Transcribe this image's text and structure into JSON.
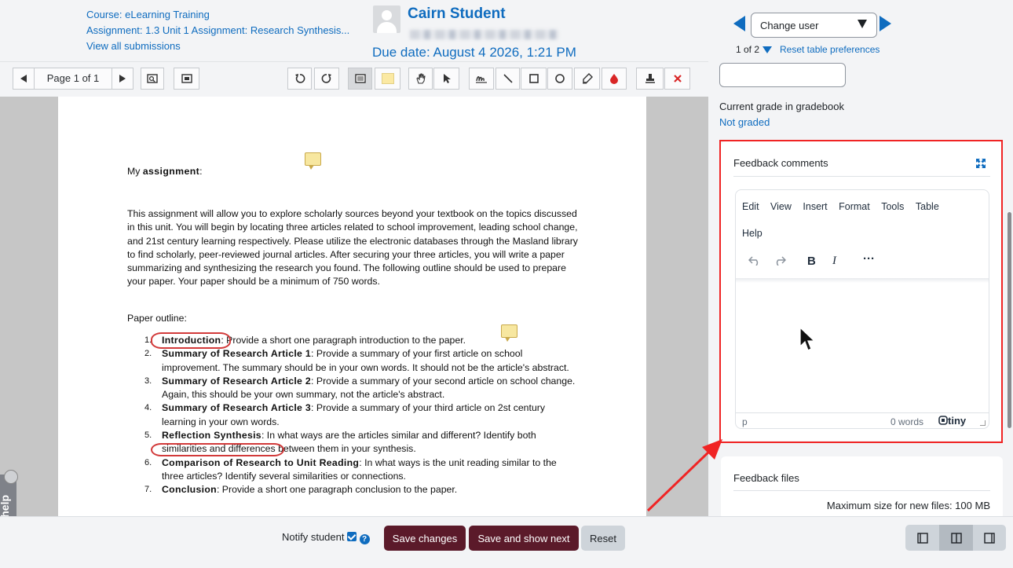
{
  "header": {
    "course_link": "Course: eLearning Training",
    "assignment_link": "Assignment: 1.3 Unit 1 Assignment: Research Synthesis...",
    "view_all": "View all submissions",
    "student_name": "Cairn Student",
    "due_date": "Due date: August 4 2026, 1:21 PM",
    "change_user": "Change user",
    "pager": "1 of 2",
    "reset_prefs": "Reset table preferences"
  },
  "toolbar": {
    "page_label": "Page 1 of 1"
  },
  "document": {
    "heading_prefix": "My ",
    "heading_bold": "assignment",
    "heading_suffix": ":",
    "paragraph": "This assignment will allow you to explore scholarly sources beyond your textbook on the topics discussed in this unit. You will begin by locating three articles related to school improvement, leading school change, and 21st century learning respectively. Please utilize the electronic databases through the Masland library to find scholarly, peer-reviewed journal articles. After securing your three articles, you will write a paper summarizing and synthesizing the research you found. The following outline should be used to prepare your paper. Your paper should be a minimum of 750 words.",
    "outline_label": "Paper outline:",
    "items": [
      {
        "num": "1.",
        "title": "Introduction",
        "text": ": Provide a short one paragraph introduction to the paper."
      },
      {
        "num": "2.",
        "title": "Summary of Research Article 1",
        "text": ": Provide a summary of your first article on school improvement. The summary should be in your own words. It should not be the article's abstract."
      },
      {
        "num": "3.",
        "title": "Summary of Research Article 2",
        "text": ": Provide a summary of your second article on school change. Again, this should be your own summary, not the article's abstract."
      },
      {
        "num": "4.",
        "title": "Summary of Research Article 3",
        "text": ": Provide a summary of your third article on 2st century learning in your own words."
      },
      {
        "num": "5.",
        "title": "Reflection Synthesis",
        "text": ": In what ways are the articles similar and different? Identify both similarities and differences between them in your synthesis."
      },
      {
        "num": "6.",
        "title": "Comparison of Research to Unit Reading",
        "text": ": In what ways is the unit reading similar to the three articles? Identify several similarities or connections."
      },
      {
        "num": "7.",
        "title": "Conclusion",
        "text": ": Provide a short one paragraph conclusion to the paper."
      }
    ]
  },
  "live_help": "live help",
  "grading": {
    "current_grade_label": "Current grade in gradebook",
    "current_grade_value": "Not graded"
  },
  "feedback": {
    "title": "Feedback comments",
    "menu": [
      "Edit",
      "View",
      "Insert",
      "Format",
      "Tools",
      "Table",
      "Help"
    ],
    "status_path": "p",
    "word_count": "0 words",
    "brand": "tiny"
  },
  "feedback_files": {
    "title": "Feedback files",
    "max_size": "Maximum size for new files: 100 MB"
  },
  "bottom": {
    "notify_label": "Notify student",
    "help_glyph": "?",
    "save_changes": "Save changes",
    "save_next": "Save and show next",
    "reset": "Reset"
  },
  "colors": {
    "link": "#0f6cbf",
    "primary_button": "#5b1a2a",
    "highlight_box": "#f02424"
  }
}
